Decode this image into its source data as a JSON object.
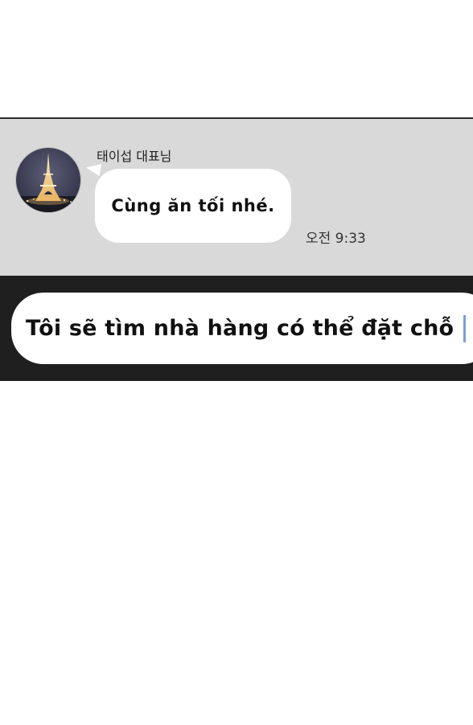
{
  "message": {
    "sender": "태이섭 대표님",
    "text": "Cùng ăn tối nhé.",
    "time": "오전 9:33"
  },
  "input": {
    "value": "Tôi sẽ tìm nhà hàng có thể đặt chỗ"
  },
  "colors": {
    "chat_background": "#d9d9d9",
    "input_bar_background": "#1f1f1f",
    "caret": "#7d9ed8"
  }
}
